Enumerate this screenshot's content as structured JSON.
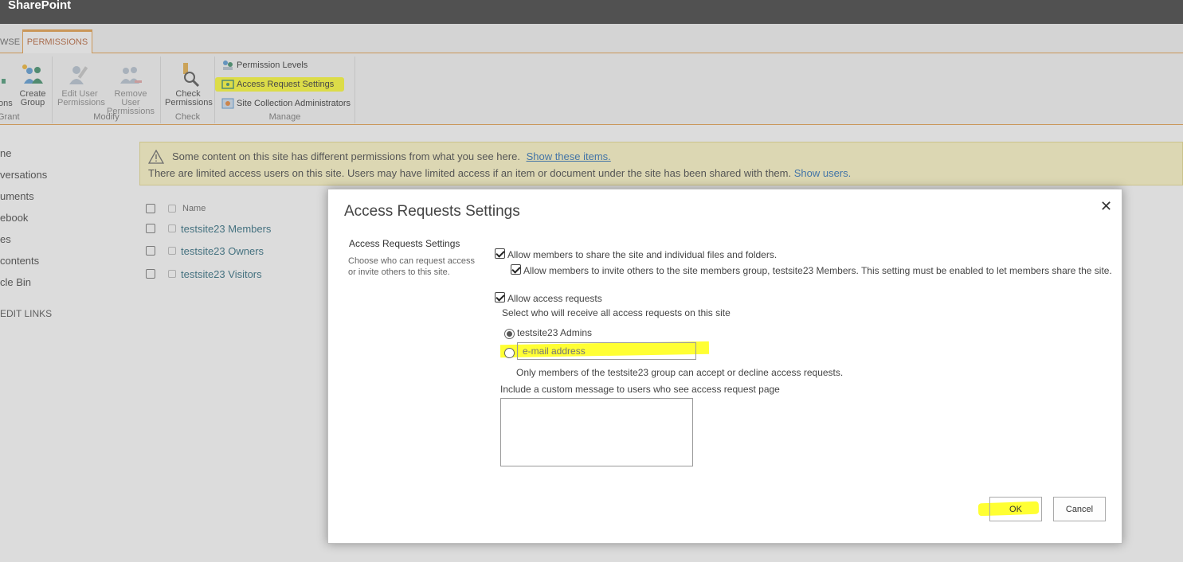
{
  "suite": {
    "brand": "SharePoint"
  },
  "ribbon": {
    "tabs": {
      "browse": "WSE",
      "permissions": "PERMISSIONS"
    },
    "grant": {
      "partial_button": "ons",
      "create_group": [
        "Create",
        "Group"
      ],
      "label": "Grant"
    },
    "modify": {
      "edit_user": [
        "Edit User",
        "Permissions"
      ],
      "remove_user": [
        "Remove User",
        "Permissions"
      ],
      "label": "Modify"
    },
    "check": {
      "check_permissions": [
        "Check",
        "Permissions"
      ],
      "label": "Check"
    },
    "manage": {
      "permission_levels": "Permission Levels",
      "access_request_settings": "Access Request Settings",
      "site_collection_admins": "Site Collection Administrators",
      "label": "Manage"
    }
  },
  "leftnav": {
    "items": [
      "ne",
      "versations",
      "uments",
      "ebook",
      "es",
      "contents",
      "cle Bin"
    ],
    "edit_links": "EDIT LINKS"
  },
  "warning": {
    "line1": "Some content on this site has different permissions from what you see here.",
    "line1_link": "Show these items.",
    "line2": "There are limited access users on this site. Users may have limited access if an item or document under the site has been shared with them.",
    "line2_link": "Show users."
  },
  "list": {
    "header": "Name",
    "rows": [
      "testsite23 Members",
      "testsite23 Owners",
      "testsite23 Visitors"
    ]
  },
  "dialog": {
    "title": "Access Requests Settings",
    "close": "✕",
    "section_title": "Access Requests Settings",
    "section_desc": "Choose who can request access or invite others to this site.",
    "allow_share": "Allow members to share the site and individual files and folders.",
    "allow_invite": "Allow members to invite others to the site members group, testsite23 Members. This setting must be enabled to let members share the site.",
    "allow_requests": "Allow access requests",
    "select_who": "Select who will receive all access requests on this site",
    "option_admins": "testsite23 Admins",
    "email_placeholder": "e-mail address",
    "only_members": "Only members of the testsite23 group can accept or decline access requests.",
    "custom_message_label": "Include a custom message to users who see access request page",
    "ok": "OK",
    "cancel": "Cancel"
  },
  "colors": {
    "accent": "#e6a04a",
    "highlight": "#ffff33",
    "link": "#2b6fb5",
    "suitebar": "#515151"
  }
}
